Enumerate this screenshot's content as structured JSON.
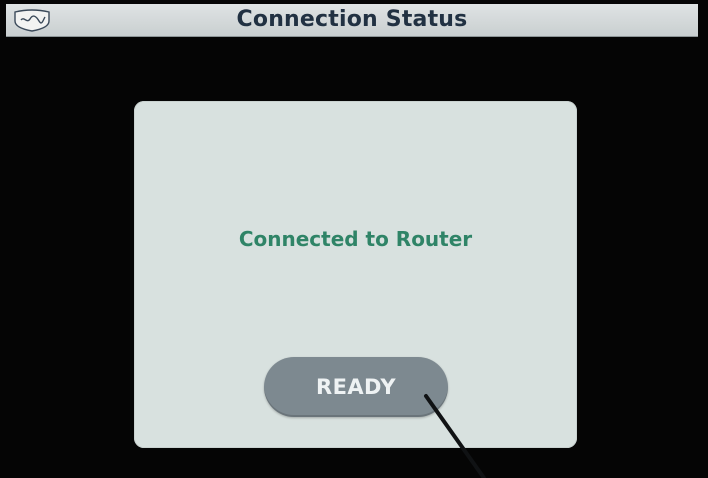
{
  "header": {
    "title": "Connection Status",
    "logo_icon": "shield-logo-icon"
  },
  "content": {
    "status_text": "Connected to Router"
  },
  "actions": {
    "ready_label": "READY"
  },
  "colors": {
    "screen_background": "#050505",
    "titlebar": "#d3d8d9",
    "title_text": "#213142",
    "card_background": "#d8e1df",
    "status_text": "#2f8467",
    "button_fill": "#7d8990",
    "button_text": "#eef2f3"
  }
}
